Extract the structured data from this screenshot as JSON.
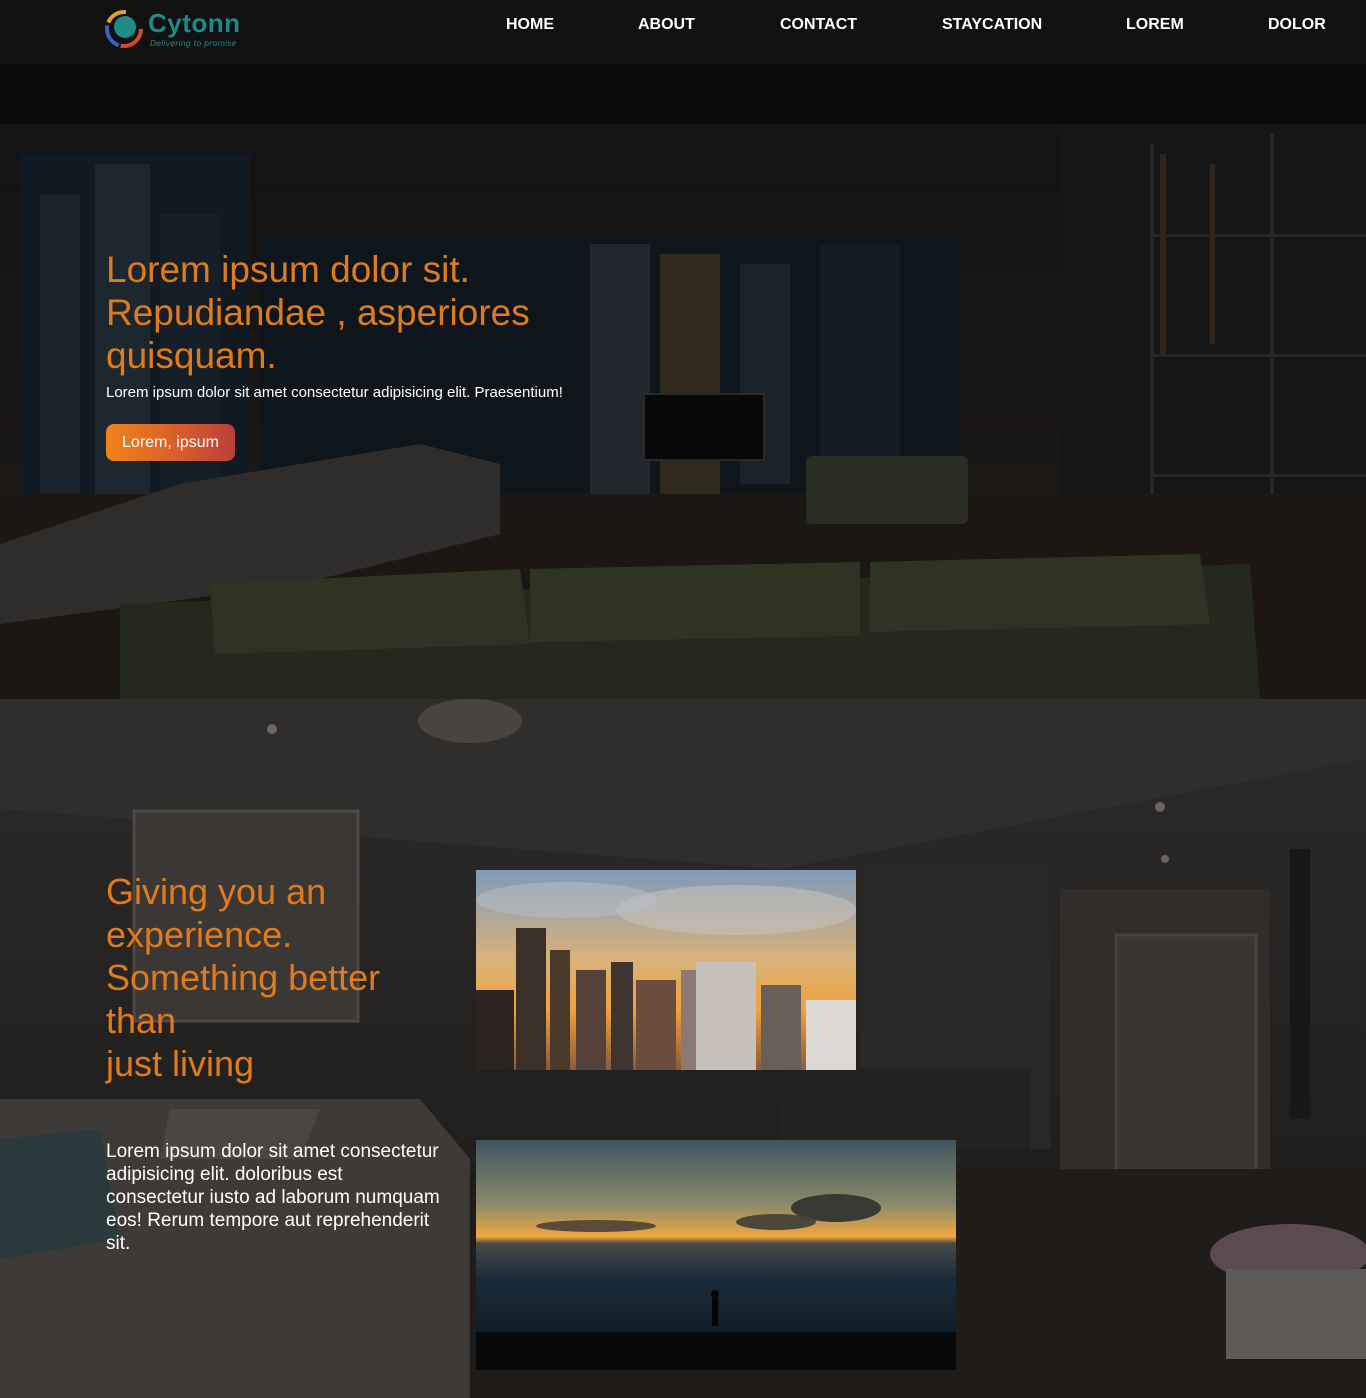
{
  "brand": {
    "name": "Cytonn",
    "tagline": "Delivering to promise",
    "primary_color": "#1f8a86",
    "accent_color": "#e07b1c"
  },
  "nav": {
    "items": [
      {
        "label": "HOME"
      },
      {
        "label": "ABOUT"
      },
      {
        "label": "CONTACT"
      },
      {
        "label": "STAYCATION"
      },
      {
        "label": "LOREM"
      },
      {
        "label": "DOLOR"
      }
    ]
  },
  "hero": {
    "title": "Lorem ipsum dolor sit. Repudiandae , asperiores quisquam.",
    "subtitle": "Lorem ipsum dolor sit amet consectetur adipisicing elit. Praesentium!",
    "button_label": "Lorem, ipsum",
    "background": "dark-loft-living-room-photo"
  },
  "experience": {
    "title_lines": [
      "Giving you an",
      "experience.",
      "Something better",
      "than",
      "just living"
    ],
    "body": "Lorem ipsum dolor sit amet consectetur adipisicing elit. doloribus est consectetur iusto ad laborum numquam eos! Rerum tempore aut reprehenderit sit.",
    "background": "dim-apartment-interior-photo",
    "images": [
      {
        "name": "city-skyline-sunset-photo"
      },
      {
        "name": "ocean-sunset-silhouette-photo"
      }
    ]
  }
}
